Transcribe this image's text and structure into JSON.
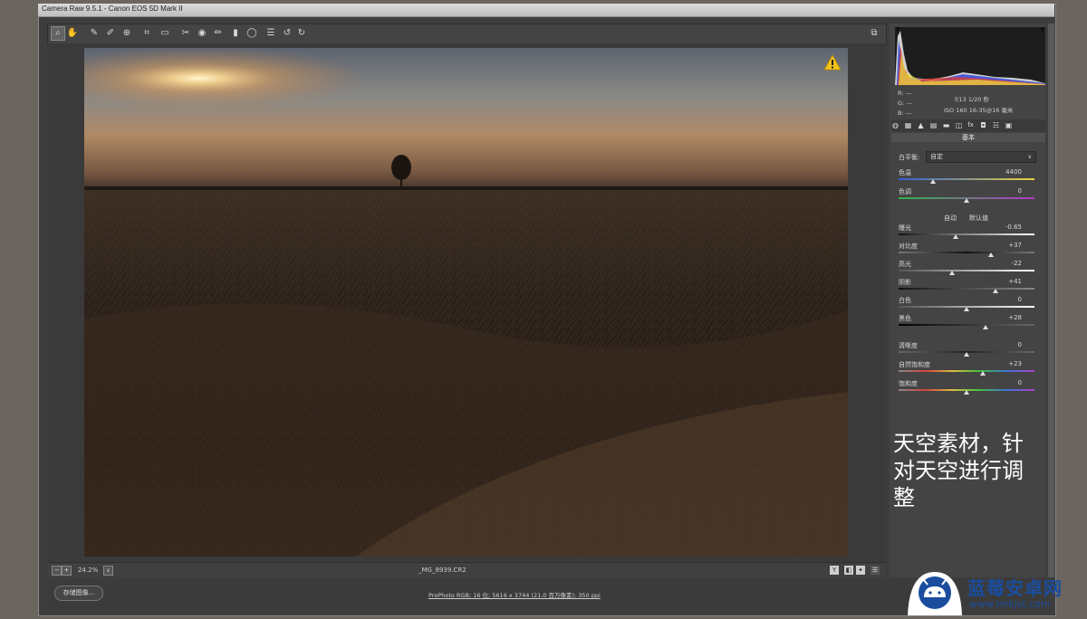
{
  "window": {
    "title": "Camera Raw 9.5.1 -  Canon EOS 5D Mark II"
  },
  "toolbar": {
    "tools": [
      {
        "name": "zoom-tool",
        "glyph": "⌕"
      },
      {
        "name": "hand-tool",
        "glyph": "✋"
      },
      {
        "name": "white-balance-tool",
        "glyph": "✎"
      },
      {
        "name": "color-sampler-tool",
        "glyph": "✐"
      },
      {
        "name": "targeted-adjustment-tool",
        "glyph": "⊕"
      },
      {
        "name": "crop-tool",
        "glyph": "⌗"
      },
      {
        "name": "straighten-tool",
        "glyph": "▭"
      },
      {
        "name": "spot-removal-tool",
        "glyph": "✂"
      },
      {
        "name": "red-eye-tool",
        "glyph": "◉"
      },
      {
        "name": "adjustment-brush-tool",
        "glyph": "✏"
      },
      {
        "name": "graduated-filter-tool",
        "glyph": "▮"
      },
      {
        "name": "radial-filter-tool",
        "glyph": "◯"
      },
      {
        "name": "preferences-tool",
        "glyph": "☰"
      },
      {
        "name": "rotate-ccw-tool",
        "glyph": "↺"
      },
      {
        "name": "rotate-cw-tool",
        "glyph": "↻"
      }
    ],
    "fullscreen_glyph": "⧉"
  },
  "status": {
    "zoom_minus": "−",
    "zoom_plus": "+",
    "zoom": "24.2%",
    "zoom_dropdown": "∨",
    "filename": "_MG_8939.CR2",
    "y_glyph": "Y",
    "icons": [
      "◧",
      "✦",
      "☰"
    ]
  },
  "bottom": {
    "save_label": "存储图像...",
    "workflow": "ProPhoto RGB; 16 位; 5616 x 3744 (21.0 百万像素); 350 ppi"
  },
  "camera_info": {
    "r": "R:  ---",
    "g": "G:  ---",
    "b": "B:  ---",
    "aperture_shutter": "f/13   1/20 秒",
    "iso_lens": "ISO 160   16-35@16 毫米"
  },
  "panel": {
    "tabs": [
      "◍",
      "▦",
      "▲",
      "▤",
      "▬",
      "◫",
      "fx",
      "◘",
      "☵",
      "▣"
    ],
    "header": "基本",
    "white_balance_label": "白平衡:",
    "white_balance_value": "自定",
    "auto": "自动",
    "default": "默认值",
    "sliders": {
      "temperature": {
        "label": "色温",
        "value": "4400",
        "pos": 0.25
      },
      "tint": {
        "label": "色调",
        "value": "0",
        "pos": 0.5
      },
      "exposure": {
        "label": "曝光",
        "value": "-0.65",
        "pos": 0.42
      },
      "contrast": {
        "label": "对比度",
        "value": "+37",
        "pos": 0.68
      },
      "highlights": {
        "label": "高光",
        "value": "-22",
        "pos": 0.39
      },
      "shadows": {
        "label": "阴影",
        "value": "+41",
        "pos": 0.71
      },
      "whites": {
        "label": "白色",
        "value": "0",
        "pos": 0.5
      },
      "blacks": {
        "label": "黑色",
        "value": "+28",
        "pos": 0.64
      },
      "clarity": {
        "label": "清晰度",
        "value": "0",
        "pos": 0.5
      },
      "vibrance": {
        "label": "自然饱和度",
        "value": "+23",
        "pos": 0.62
      },
      "saturation": {
        "label": "饱和度",
        "value": "0",
        "pos": 0.5
      }
    }
  },
  "overlay": {
    "text": "天空素材，针对天空进行调整"
  },
  "watermark": {
    "title": "蓝莓安卓网",
    "url": "www.lmkjst.com"
  },
  "colors": {
    "accent": "#1a4d9e",
    "panel": "#444444",
    "bg": "#3d3d3d"
  }
}
